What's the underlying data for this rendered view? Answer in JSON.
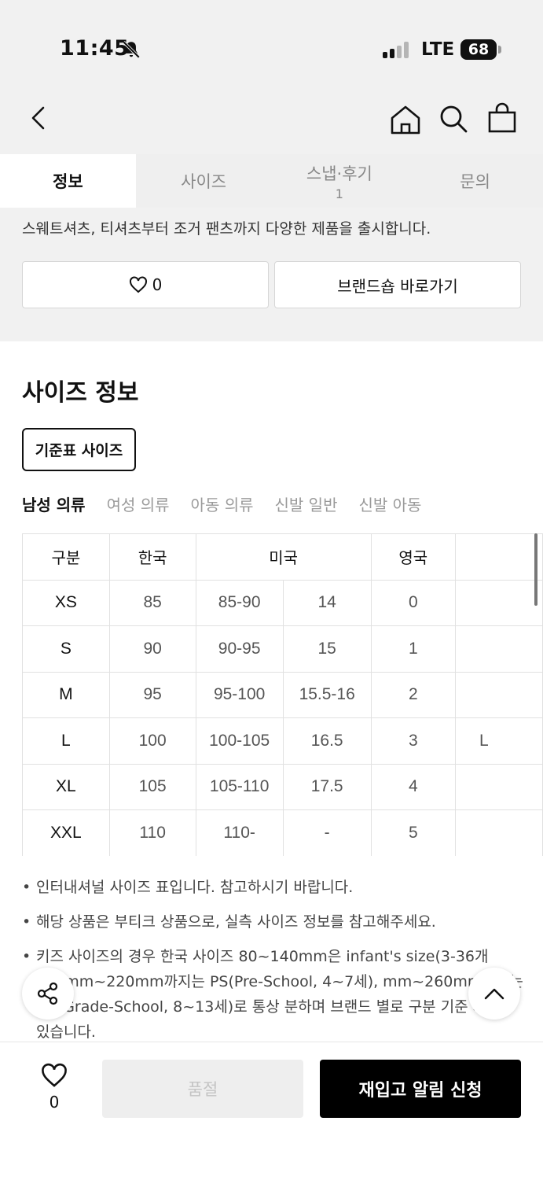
{
  "status": {
    "time": "11:45",
    "network": "LTE",
    "battery": "68"
  },
  "tabs": [
    {
      "label": "정보",
      "count": ""
    },
    {
      "label": "사이즈",
      "count": ""
    },
    {
      "label": "스냅·후기",
      "count": "1"
    },
    {
      "label": "문의",
      "count": ""
    }
  ],
  "brand": {
    "description": "스웨트셔츠, 티셔츠부터 조거 팬츠까지 다양한 제품을 출시합니다.",
    "like_count": "0",
    "shop_button": "브랜드숍 바로가기"
  },
  "size_section": {
    "title": "사이즈 정보",
    "standard_button": "기준표 사이즈",
    "categories": [
      "남성 의류",
      "여성 의류",
      "아동 의류",
      "신발 일반",
      "신발 아동"
    ],
    "table": {
      "headers": [
        "구분",
        "한국",
        "미국",
        "영국"
      ],
      "rows": [
        [
          "XS",
          "85",
          "85-90",
          "14",
          "0",
          ""
        ],
        [
          "S",
          "90",
          "90-95",
          "15",
          "1",
          ""
        ],
        [
          "M",
          "95",
          "95-100",
          "15.5-16",
          "2",
          ""
        ],
        [
          "L",
          "100",
          "100-105",
          "16.5",
          "3",
          "L"
        ],
        [
          "XL",
          "105",
          "105-110",
          "17.5",
          "4",
          ""
        ],
        [
          "XXL",
          "110",
          "110-",
          "-",
          "5",
          ""
        ]
      ]
    },
    "notes": [
      "인터내셔널 사이즈 표입니다. 참고하시기 바랍니다.",
      "해당 상품은 부티크 상품으로, 실측 사이즈 정보를 참고해주세요.",
      "키즈 사이즈의 경우 한국 사이즈 80~140mm은 infant's size(3-36개 145mm~220mm까지는 PS(Pre-School, 4~7세), mm~260mm까지는 GS(Grade-School, 8~13세)로 통상 분하며 브랜드 별로 구분 기준 차이가 있습니다."
    ]
  },
  "bottom_bar": {
    "like_count": "0",
    "soldout_label": "품절",
    "restock_label": "재입고 알림 신청"
  }
}
